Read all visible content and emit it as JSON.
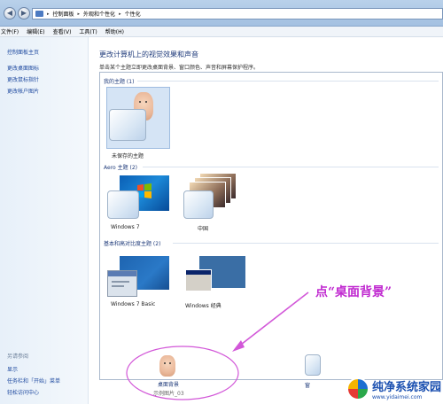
{
  "address_bar": {
    "crumbs": [
      "控制面板",
      "外观和个性化",
      "个性化"
    ]
  },
  "menu": {
    "items": [
      "文件(F)",
      "编辑(E)",
      "查看(V)",
      "工具(T)",
      "帮助(H)"
    ]
  },
  "left_pane": {
    "links": [
      "控制面板主页",
      "更改桌面图标",
      "更改鼠标指针",
      "更改帐户图片"
    ],
    "see_also_heading": "另请参阅",
    "see_also": [
      "显示",
      "任务栏和「开始」菜单",
      "轻松访问中心"
    ]
  },
  "main": {
    "title": "更改计算机上的视觉效果和声音",
    "description": "单击某个主题立即更改桌面背景、窗口颜色、声音和屏幕保护程序。",
    "groups": {
      "my_themes": {
        "label": "我的主题 (1)",
        "items": [
          {
            "caption": "未保存的主题"
          }
        ]
      },
      "aero": {
        "label": "Aero 主题 (2)",
        "items": [
          {
            "caption": "Windows 7"
          },
          {
            "caption": "中国"
          }
        ]
      },
      "basic": {
        "label": "基本和高对比度主题 (2)",
        "items": [
          {
            "caption": "Windows 7 Basic"
          },
          {
            "caption": "Windows 经典"
          }
        ]
      }
    }
  },
  "bottom": {
    "desktop_background": {
      "label": "桌面背景",
      "sublabel": "示例图片_03"
    },
    "second_item_partial": "窗"
  },
  "annotation": {
    "text": "点“桌面背景”",
    "color": "#c02ad0"
  },
  "watermark": {
    "main": "纯净系统家园",
    "sub": "www.yidaimei.com"
  },
  "icons": {
    "back": "back-arrow-icon",
    "forward": "forward-arrow-icon",
    "folder": "control-panel-folder-icon"
  }
}
